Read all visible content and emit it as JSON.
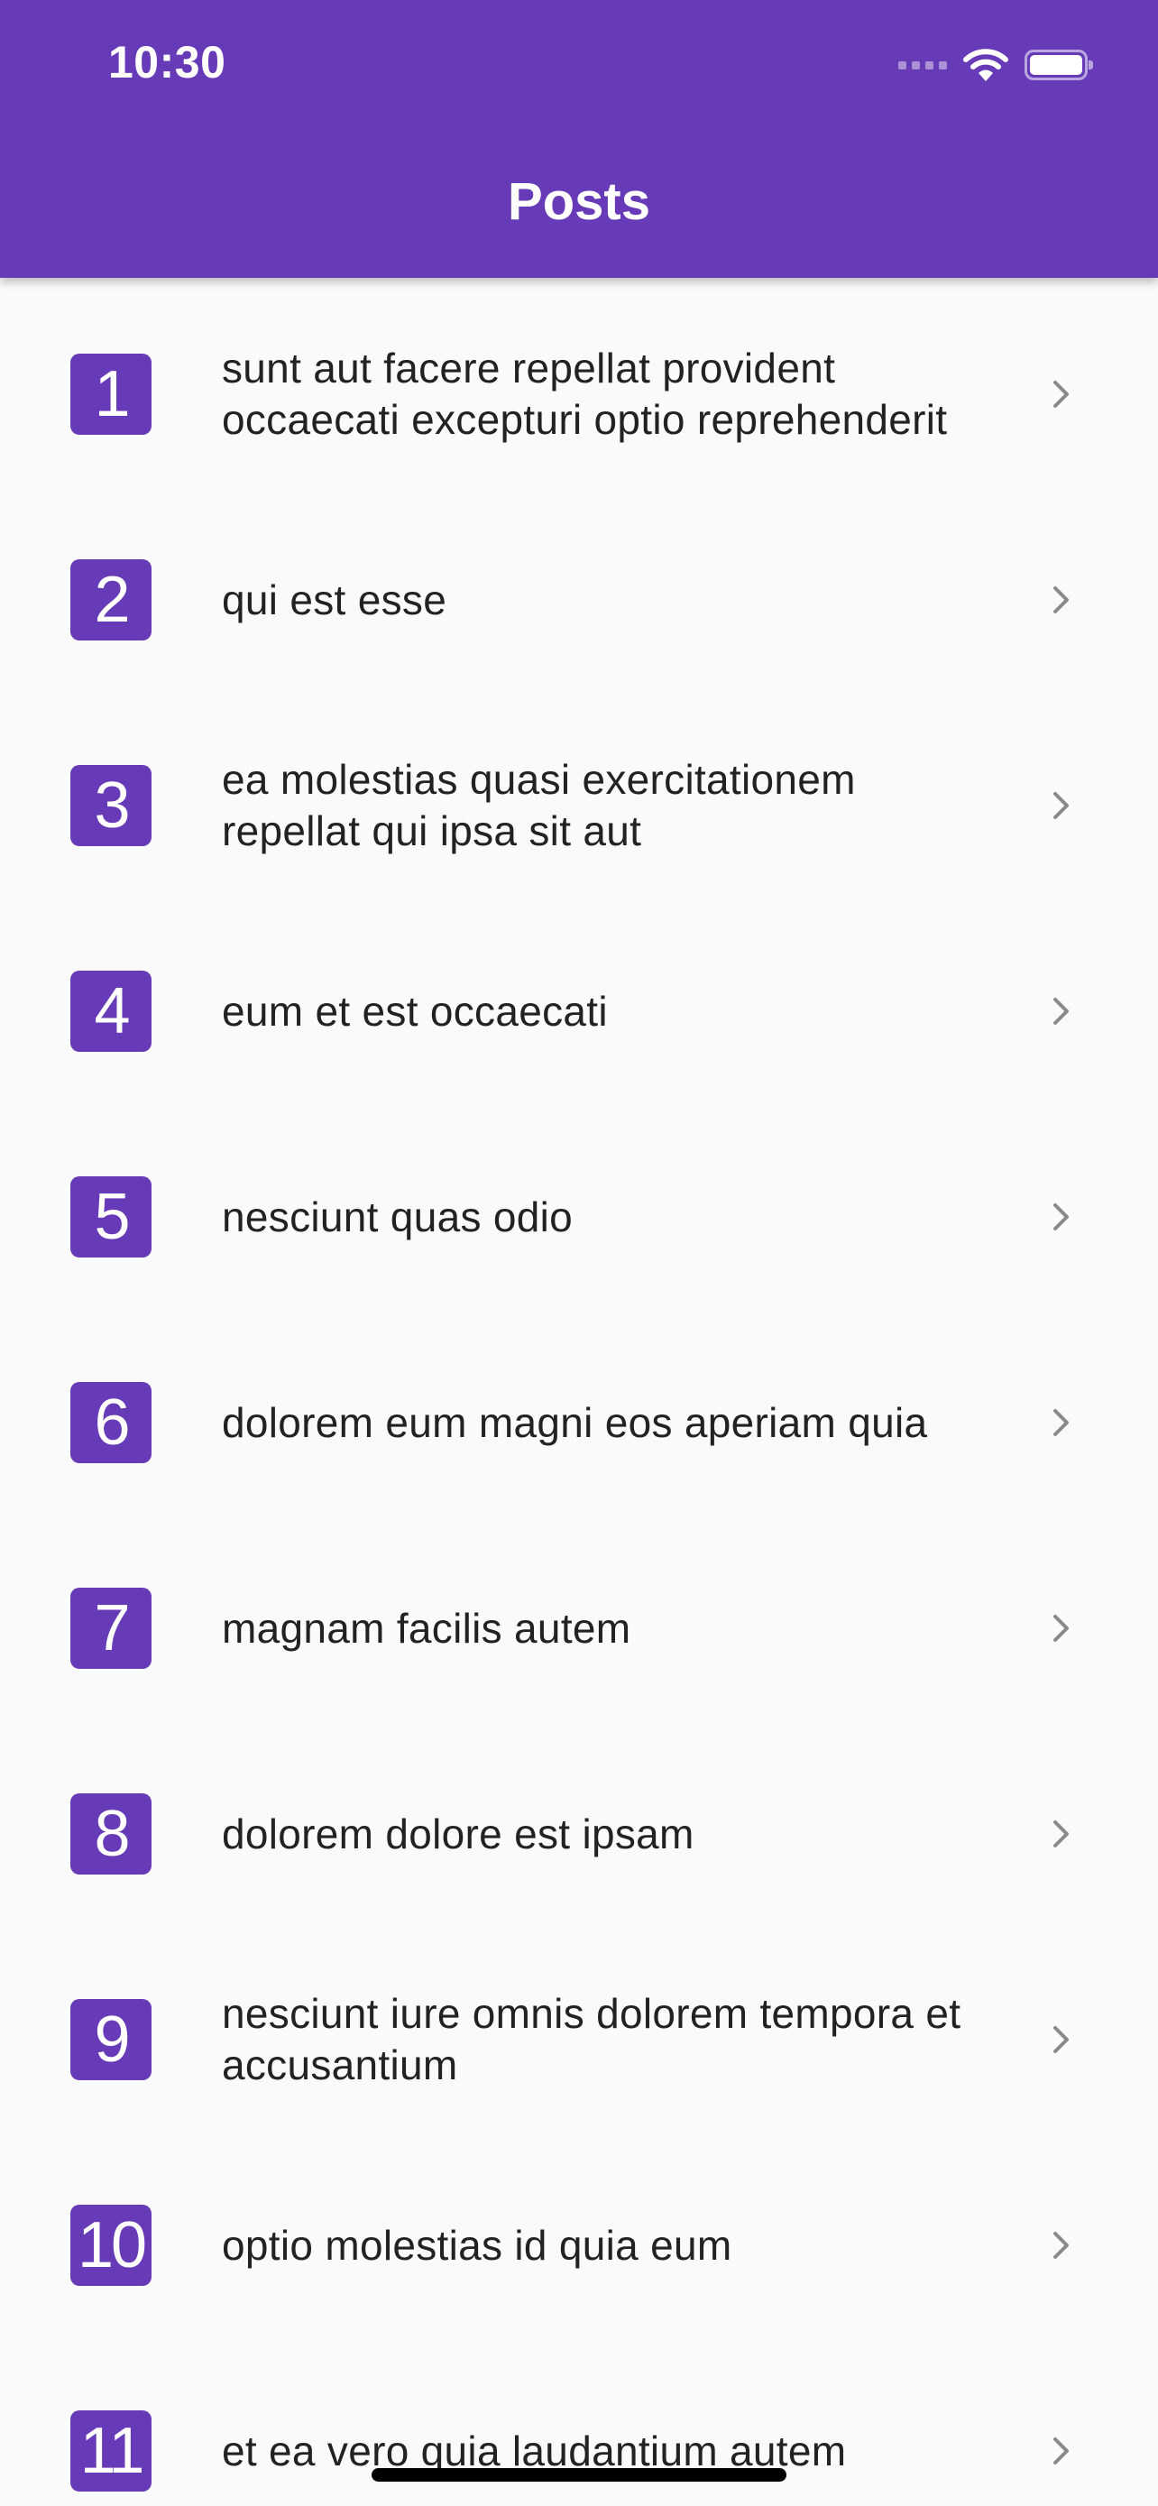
{
  "status_bar": {
    "time": "10:30",
    "icons": [
      "cellular-signal-icon",
      "wifi-icon",
      "battery-icon"
    ],
    "battery_level": 1.0
  },
  "app_bar": {
    "title": "Posts",
    "background_color": "#673AB7"
  },
  "colors": {
    "accent": "#673AB7",
    "background": "#FAFAFA",
    "text": "#222222",
    "chevron": "#8A8A8A"
  },
  "posts": [
    {
      "id": "1",
      "title": "sunt aut facere repellat provident occaecati excepturi optio reprehenderit"
    },
    {
      "id": "2",
      "title": "qui est esse"
    },
    {
      "id": "3",
      "title": "ea molestias quasi exercitationem repellat qui ipsa sit aut"
    },
    {
      "id": "4",
      "title": "eum et est occaecati"
    },
    {
      "id": "5",
      "title": "nesciunt quas odio"
    },
    {
      "id": "6",
      "title": "dolorem eum magni eos aperiam quia"
    },
    {
      "id": "7",
      "title": "magnam facilis autem"
    },
    {
      "id": "8",
      "title": "dolorem dolore est ipsam"
    },
    {
      "id": "9",
      "title": "nesciunt iure omnis dolorem tempora et accusantium"
    },
    {
      "id": "10",
      "title": "optio molestias id quia eum"
    },
    {
      "id": "11",
      "title": "et ea vero quia laudantium autem"
    }
  ],
  "row_icon": "chevron-right-icon"
}
